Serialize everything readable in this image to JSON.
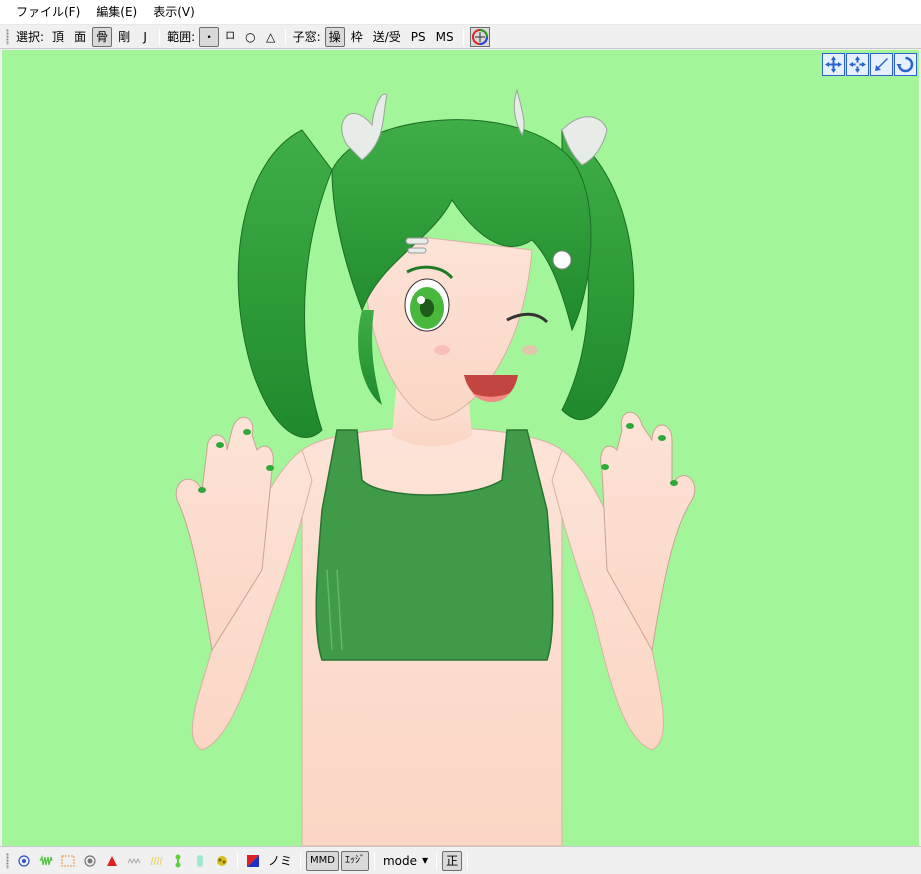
{
  "menu": {
    "file": "ファイル(F)",
    "edit": "編集(E)",
    "view": "表示(V)"
  },
  "toolbar": {
    "select_label": "選択:",
    "select_vertex": "頂",
    "select_face": "面",
    "select_bone": "骨",
    "select_rigid": "剛",
    "select_joint": "J",
    "range_label": "範囲:",
    "range_point": "・",
    "range_rect": "ロ",
    "range_circle": "○",
    "range_triangle": "△",
    "subwindow_label": "子窓:",
    "sub_operation": "操",
    "sub_frame": "枠",
    "sub_send_receive": "送/受",
    "sub_ps": "PS",
    "sub_ms": "MS"
  },
  "viewport": {
    "background": "#a3f59a",
    "nav_icons": [
      "move-view-icon",
      "pan-view-icon",
      "zoom-view-icon",
      "rotate-view-icon"
    ]
  },
  "statusbar": {
    "color_swatch_label": "ノミ",
    "mmd_button": "MMD",
    "edge_button": "ｴｯｼﾞ",
    "mode_label": "mode",
    "ortho_button": "正"
  }
}
